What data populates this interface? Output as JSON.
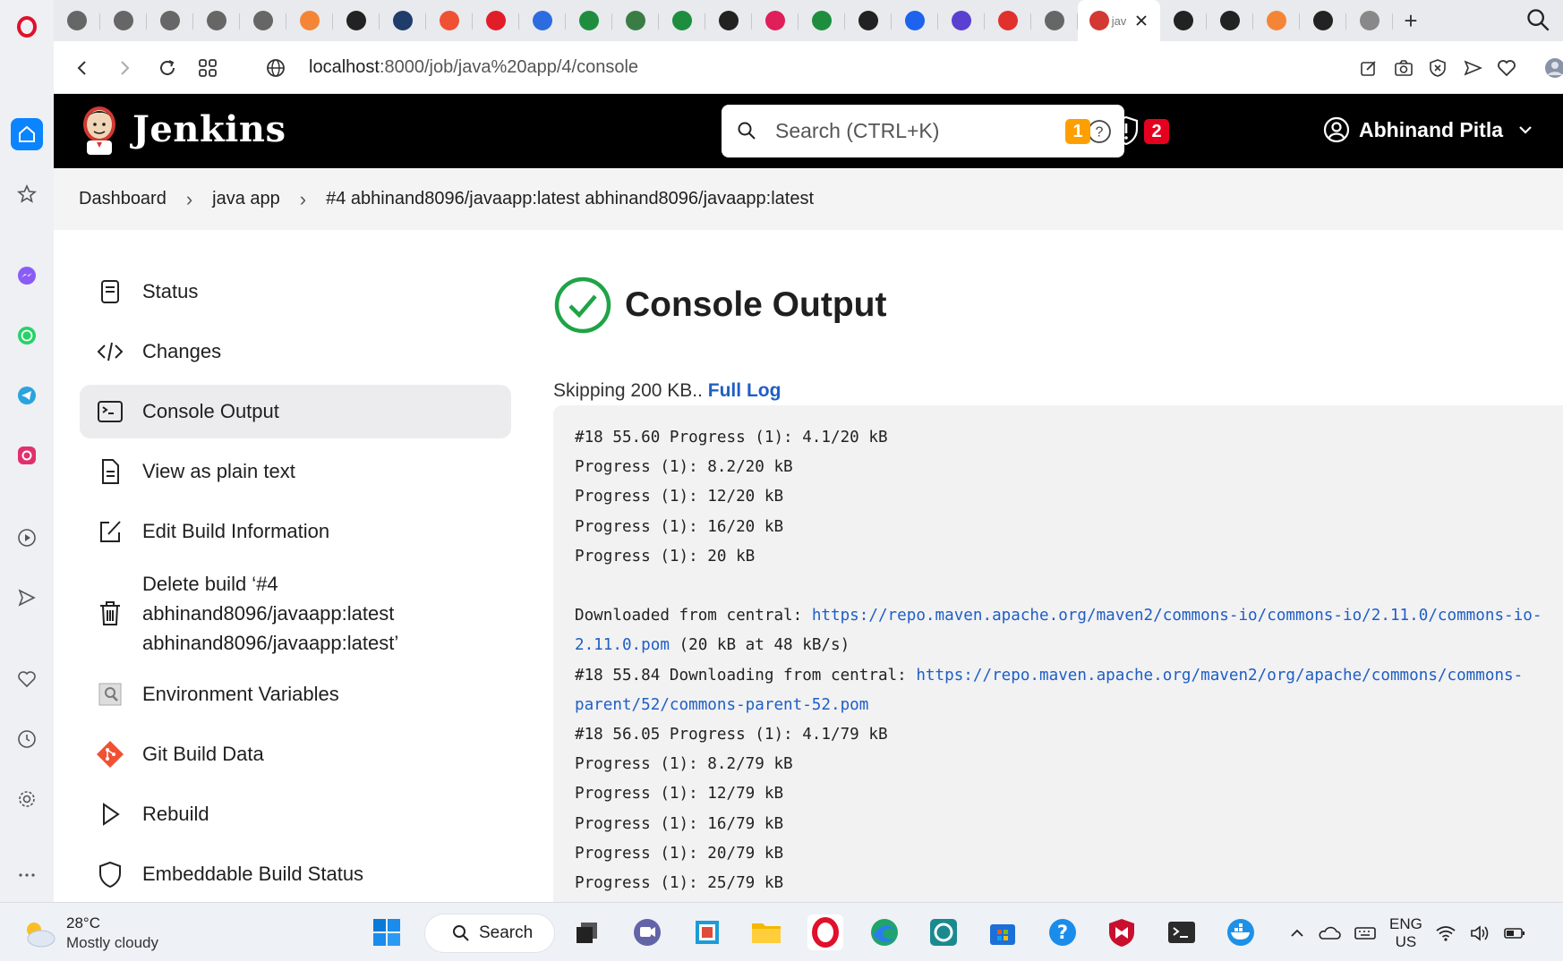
{
  "browser": {
    "tabs": [
      {
        "icon": "opera-gx-icon",
        "color": "#666"
      },
      {
        "icon": "opera-gx-icon",
        "color": "#666"
      },
      {
        "icon": "opera-gx-icon",
        "color": "#666"
      },
      {
        "icon": "opera-gx-icon",
        "color": "#666"
      },
      {
        "icon": "opera-gx-icon",
        "color": "#666"
      },
      {
        "icon": "aws-icon",
        "color": "#f58536"
      },
      {
        "icon": "github-icon",
        "color": "#222"
      },
      {
        "icon": "cube-icon",
        "color": "#1f3c6b"
      },
      {
        "icon": "git-diamond-icon",
        "color": "#f05133"
      },
      {
        "icon": "v-icon",
        "color": "#e21d2a"
      },
      {
        "icon": "z-icon",
        "color": "#2d6cdf"
      },
      {
        "icon": "plus-green-icon",
        "color": "#1e8e3e"
      },
      {
        "icon": "y-icon",
        "color": "#3a7d44"
      },
      {
        "icon": "plus-green-icon",
        "color": "#1e8e3e"
      },
      {
        "icon": "github-icon",
        "color": "#222"
      },
      {
        "icon": "slack-icon",
        "color": "#e01e5a"
      },
      {
        "icon": "plus-green-icon",
        "color": "#1e8e3e"
      },
      {
        "icon": "amazon-icon",
        "color": "#222"
      },
      {
        "icon": "docker-icon",
        "color": "#1d63ed"
      },
      {
        "icon": "list-icon",
        "color": "#5b3fd1"
      },
      {
        "icon": "oracle-icon",
        "color": "#e0312d"
      },
      {
        "icon": "opera-gx-icon",
        "color": "#666"
      }
    ],
    "active_tab_label": "jav",
    "tabs_after": [
      {
        "icon": "github-icon",
        "color": "#222"
      },
      {
        "icon": "github-icon",
        "color": "#222"
      },
      {
        "icon": "aws-icon",
        "color": "#f58536"
      },
      {
        "icon": "github-icon",
        "color": "#222"
      },
      {
        "icon": "grid-icon",
        "color": "#888"
      }
    ],
    "url_host": "localhost",
    "url_path": ":8000/job/java%20app/4/console"
  },
  "jenkins": {
    "title": "Jenkins",
    "search_placeholder": "Search (CTRL+K)",
    "notifications_count": "1",
    "security_count": "2",
    "user_name": "Abhinand Pitla",
    "accent_orange": "#fe9f00",
    "accent_red": "#e6001f"
  },
  "breadcrumb": {
    "items": [
      "Dashboard",
      "java app",
      "#4 abhinand8096/javaapp:latest abhinand8096/javaapp:latest"
    ]
  },
  "tasks": [
    {
      "label": "Status",
      "icon": "notepad-icon"
    },
    {
      "label": "Changes",
      "icon": "code-icon"
    },
    {
      "label": "Console Output",
      "icon": "terminal-icon"
    },
    {
      "label": "View as plain text",
      "icon": "document-icon"
    },
    {
      "label": "Edit Build Information",
      "icon": "edit-icon"
    },
    {
      "label": "Delete build ‘#4 abhinand8096/javaapp:latest abhinand8096/javaapp:latest’",
      "icon": "trash-icon"
    },
    {
      "label": "Environment Variables",
      "icon": "env-icon"
    },
    {
      "label": "Git Build Data",
      "icon": "git-icon"
    },
    {
      "label": "Rebuild",
      "icon": "play-icon"
    },
    {
      "label": "Embeddable Build Status",
      "icon": "shield-icon"
    }
  ],
  "console": {
    "title": "Console Output",
    "skip_text": "Skipping 200 KB.. ",
    "full_log_label": "Full Log",
    "lines": [
      {
        "text": "#18 55.60 Progress (1): 4.1/20 kB"
      },
      {
        "text": "Progress (1): 8.2/20 kB"
      },
      {
        "text": "Progress (1): 12/20 kB"
      },
      {
        "text": "Progress (1): 16/20 kB"
      },
      {
        "text": "Progress (1): 20 kB"
      },
      {
        "text": ""
      },
      {
        "text": "Downloaded from central: ",
        "link": "https://repo.maven.apache.org/maven2/commons-io/commons-io/2.11.0/commons-io-"
      },
      {
        "text": "",
        "link": "2.11.0.pom",
        "after": " (20 kB at 48 kB/s)"
      },
      {
        "text": "#18 55.84 Downloading from central: ",
        "link": "https://repo.maven.apache.org/maven2/org/apache/commons/commons-"
      },
      {
        "text": "",
        "link": "parent/52/commons-parent-52.pom"
      },
      {
        "text": "#18 56.05 Progress (1): 4.1/79 kB"
      },
      {
        "text": "Progress (1): 8.2/79 kB"
      },
      {
        "text": "Progress (1): 12/79 kB"
      },
      {
        "text": "Progress (1): 16/79 kB"
      },
      {
        "text": "Progress (1): 20/79 kB"
      },
      {
        "text": "Progress (1): 25/79 kB"
      }
    ]
  },
  "taskbar": {
    "temperature": "28°C",
    "weather": "Mostly cloudy",
    "search_label": "Search",
    "lang_line1": "ENG",
    "lang_line2": "US"
  }
}
